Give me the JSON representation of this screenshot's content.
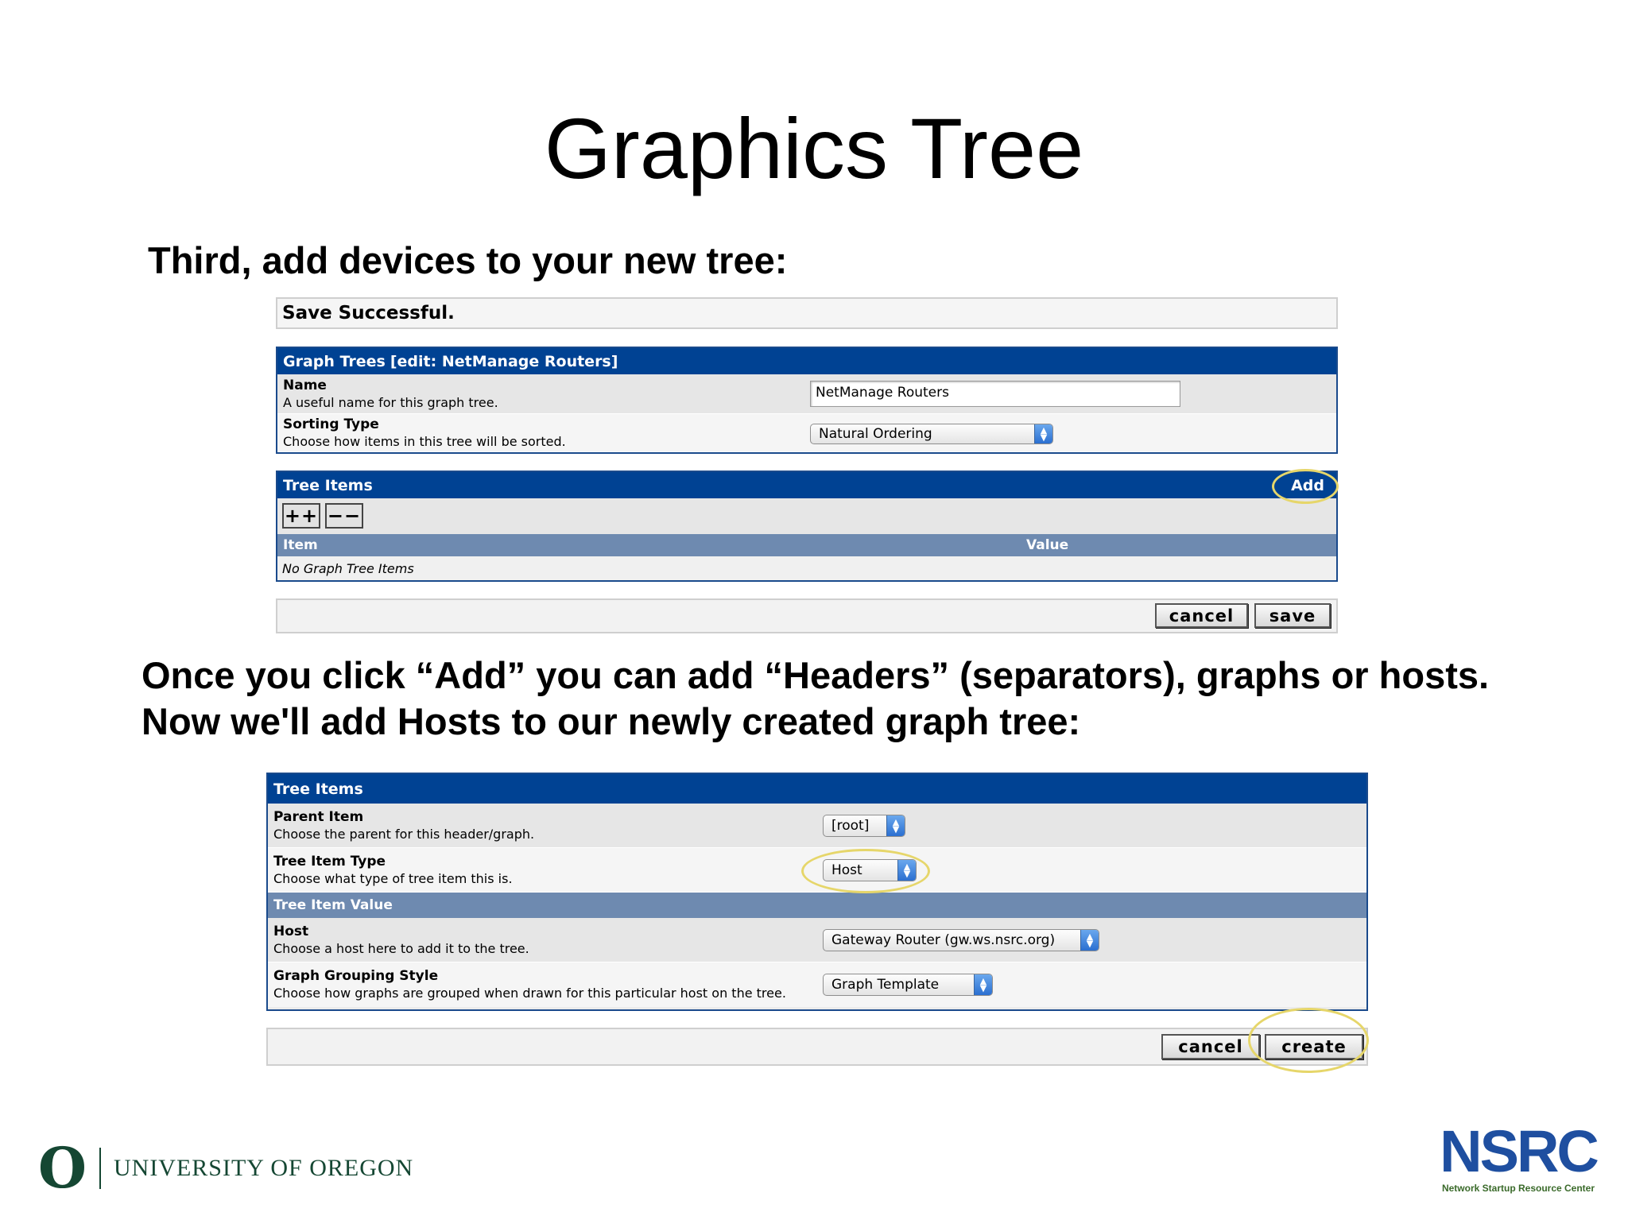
{
  "slide": {
    "title": "Graphics Tree",
    "instruction_1": "Third, add devices to your new tree:",
    "instruction_2_line1": "Once you click “Add” you can add “Headers” (separators), graphs or hosts.",
    "instruction_2_line2": "Now we'll add Hosts to our newly created graph tree:"
  },
  "save_message": "Save Successful.",
  "graph_trees_panel": {
    "title": "Graph Trees",
    "subtitle": "[edit: NetManage Routers]",
    "name_label": "Name",
    "name_desc": "A useful name for this graph tree.",
    "name_value": "NetManage Routers",
    "sorting_label": "Sorting Type",
    "sorting_desc": "Choose how items in this tree will be sorted.",
    "sorting_value": "Natural Ordering"
  },
  "tree_items_panel": {
    "title": "Tree Items",
    "add_link": "Add",
    "expand_button": "++",
    "collapse_button": "−−",
    "col_item": "Item",
    "col_value": "Value",
    "empty_text": "No Graph Tree Items"
  },
  "form_buttons_1": {
    "cancel": "cancel",
    "save": "save"
  },
  "tree_items_form": {
    "title": "Tree Items",
    "parent_label": "Parent Item",
    "parent_desc": "Choose the parent for this header/graph.",
    "parent_value": "[root]",
    "type_label": "Tree Item Type",
    "type_desc": "Choose what type of tree item this is.",
    "type_value": "Host",
    "value_header": "Tree Item Value",
    "host_label": "Host",
    "host_desc": "Choose a host here to add it to the tree.",
    "host_value": "Gateway Router (gw.ws.nsrc.org)",
    "grouping_label": "Graph Grouping Style",
    "grouping_desc": "Choose how graphs are grouped when drawn for this particular host on the tree.",
    "grouping_value": "Graph Template"
  },
  "form_buttons_2": {
    "cancel": "cancel",
    "create": "create"
  },
  "footer": {
    "uo_letter": "O",
    "uo_text": "UNIVERSITY OF OREGON",
    "nsrc_logo": "NSRC",
    "nsrc_sub": "Network Startup Resource Center"
  },
  "colors": {
    "panel_header": "#004293",
    "sub_header": "#6e8ab0",
    "highlight_ring": "#e6d66a",
    "uo_green": "#154733",
    "nsrc_blue": "#1f4fa0"
  }
}
